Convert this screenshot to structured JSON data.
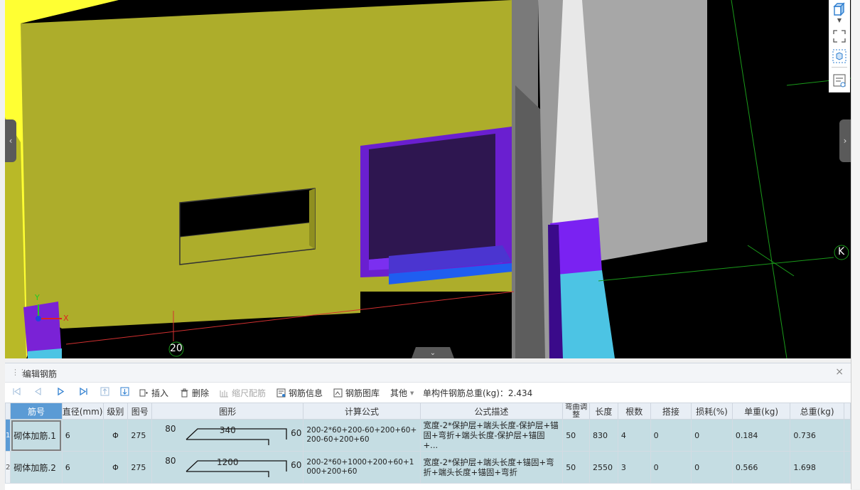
{
  "viewport": {
    "axis_labels": {
      "y": "Y",
      "x": "X"
    },
    "grid_labels": {
      "bottom": "20",
      "right": "K"
    },
    "handles": {
      "left": "‹",
      "right": "›",
      "collapse": "⌄"
    }
  },
  "right_toolbar": {
    "icons": [
      "cube-view-icon",
      "dropdown-arrow-icon",
      "fullscreen-icon",
      "component-view-icon",
      "property-view-icon"
    ]
  },
  "panel": {
    "title": "编辑钢筋",
    "close": "×"
  },
  "toolbar": {
    "insert": "插入",
    "delete": "删除",
    "scale_rebar": "缩尺配筋",
    "rebar_info": "钢筋信息",
    "rebar_library": "钢筋图库",
    "other": "其他",
    "total_weight_label": "单构件钢筋总重(kg)：2.434"
  },
  "table": {
    "columns": [
      "筋号",
      "直径(mm)",
      "级别",
      "图号",
      "图形",
      "计算公式",
      "公式描述",
      "弯曲调整",
      "长度",
      "根数",
      "搭接",
      "损耗(%)",
      "单重(kg)",
      "总重(kg)"
    ],
    "rows": [
      {
        "row_no": "1",
        "name": "砌体加筋.1",
        "diameter": "6",
        "grade": "Φ",
        "figure_no": "275",
        "shape_left": "80",
        "shape_mid": "340",
        "shape_right": "60",
        "formula": "200-2*60+200-60+200+60+200-60+200+60",
        "description": "宽度-2*保护层+端头长度-保护层+锚固+弯折+端头长度-保护层+锚固+...",
        "bend_adjust": "50",
        "length": "830",
        "count": "4",
        "lap": "0",
        "loss": "0",
        "unit_weight": "0.184",
        "total_weight": "0.736"
      },
      {
        "row_no": "2",
        "name": "砌体加筋.2",
        "diameter": "6",
        "grade": "Φ",
        "figure_no": "275",
        "shape_left": "80",
        "shape_mid": "1200",
        "shape_right": "60",
        "formula": "200-2*60+1000+200+60+1000+200+60",
        "description": "宽度-2*保护层+端头长度+锚固+弯折+端头长度+锚固+弯折",
        "bend_adjust": "50",
        "length": "2550",
        "count": "3",
        "lap": "0",
        "loss": "0",
        "unit_weight": "0.566",
        "total_weight": "1.698"
      }
    ]
  },
  "colors": {
    "wall_yellow": "#adad2b",
    "bright_yellow": "#ffff33",
    "purple": "#7a22d6",
    "cyan": "#4cc4e4",
    "selected_row": "#c5dde3",
    "header_blue": "#5b9bd5"
  }
}
